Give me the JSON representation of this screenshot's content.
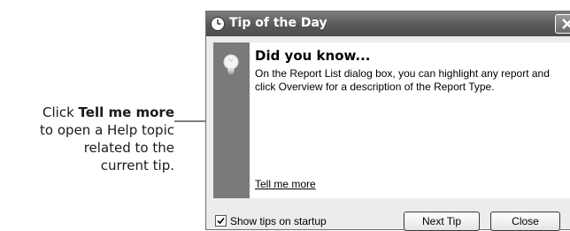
{
  "callout": {
    "line1_prefix": "Click ",
    "line1_bold": "Tell me more",
    "line2": "to open a Help topic",
    "line3": "related to the",
    "line4": "current tip."
  },
  "dialog": {
    "title": "Tip of the Day",
    "heading": "Did you know...",
    "body": "On the Report List dialog box, you can highlight any report and click Overview for a description of the Report Type.",
    "link_text": "Tell me more",
    "checkbox_label": "Show tips on startup",
    "checkbox_checked": true,
    "next_button": "Next Tip",
    "close_button": "Close"
  },
  "icons": {
    "title": "clock-icon",
    "close": "close-x-icon",
    "tip": "lightbulb-icon",
    "check": "checkmark-icon"
  },
  "colors": {
    "titlebar": "#5a5a5a",
    "sidebar": "#7a7a7a",
    "window_bg": "#ececec"
  }
}
